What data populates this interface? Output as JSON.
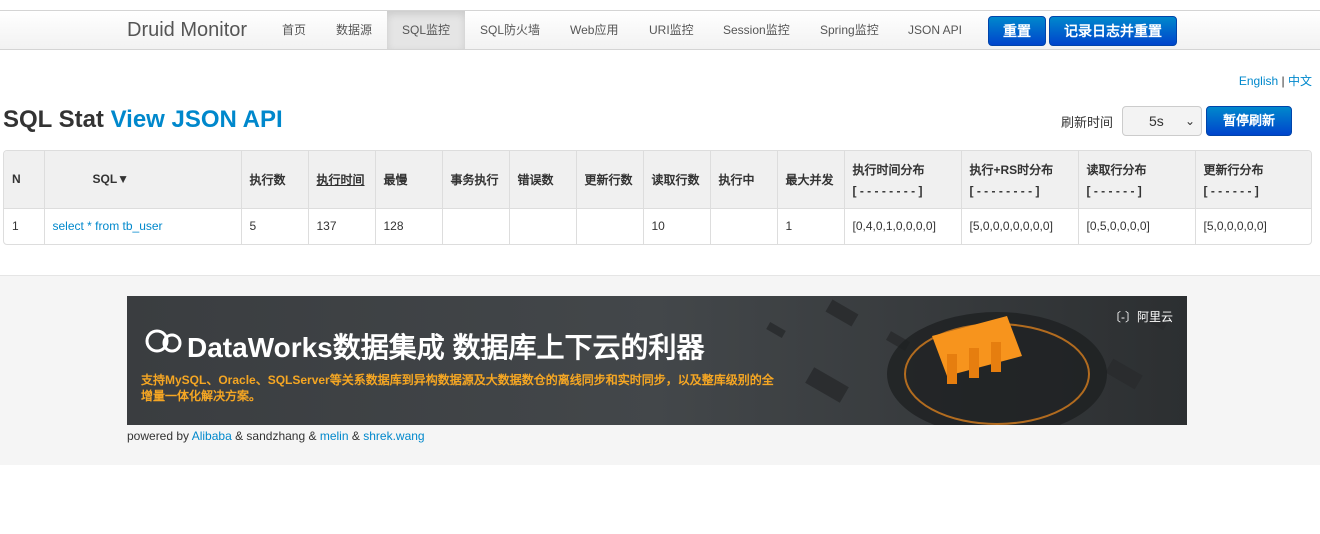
{
  "navbar": {
    "brand": "Druid Monitor",
    "items": [
      "首页",
      "数据源",
      "SQL监控",
      "SQL防火墙",
      "Web应用",
      "URI监控",
      "Session监控",
      "Spring监控",
      "JSON API"
    ],
    "active_index": 2,
    "reset_button": "重置",
    "log_reset_button": "记录日志并重置"
  },
  "lang": {
    "english": "English",
    "separator": "|",
    "chinese": "中文"
  },
  "header": {
    "title": "SQL Stat",
    "api_link": "View JSON API",
    "refresh_label": "刷新时间",
    "refresh_value": "5s",
    "pause_button": "暂停刷新"
  },
  "table": {
    "headers": [
      "N",
      "SQL▼",
      "执行数",
      "执行时间",
      "最慢",
      "事务执行",
      "错误数",
      "更新行数",
      "读取行数",
      "执行中",
      "最大并发",
      "执行时间分布",
      "执行+RS时分布",
      "读取行分布",
      "更新行分布"
    ],
    "dist_ranges": [
      "[ - - - - - - - - ]",
      "[ - - - - - - - - ]",
      "[ - - - - - - ]",
      "[ - - - - - - ]"
    ],
    "rows": [
      [
        "1",
        "select * from tb_user",
        "5",
        "137",
        "128",
        "",
        "",
        "",
        "10",
        "",
        "1",
        "[0,4,0,1,0,0,0,0]",
        "[5,0,0,0,0,0,0,0]",
        "[0,5,0,0,0,0]",
        "[5,0,0,0,0,0]"
      ]
    ]
  },
  "banner": {
    "title": "DataWorks数据集成 数据库上下云的利器",
    "subtitle": "支持MySQL、Oracle、SQLServer等关系数据库到异构数据源及大数据数仓的离线同步和实时同步，以及整库级别的全增量一体化解决方案。",
    "brand": "〔-〕阿里云"
  },
  "footer": {
    "powered_by": "powered by",
    "alibaba": "Alibaba",
    "and1": "& sandzhang &",
    "melin": "melin",
    "and2": "&",
    "shrek": "shrek.wang"
  },
  "colors": {
    "link": "#0088cc",
    "primary_button": "#0055cc",
    "banner_accent": "#f5a623"
  }
}
